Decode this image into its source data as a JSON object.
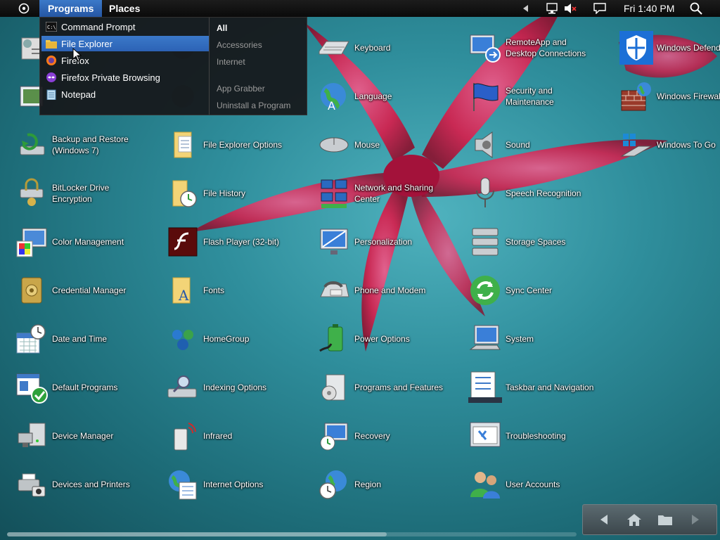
{
  "topbar": {
    "menus": [
      "Programs",
      "Places"
    ],
    "clock": "Fri 1:40 PM"
  },
  "programs_menu": {
    "programs": [
      "Command Prompt",
      "File Explorer",
      "Firefox",
      "Firefox Private Browsing",
      "Notepad"
    ],
    "highlighted": "File Explorer",
    "categories": [
      "All",
      "Accessories",
      "Internet",
      "App Grabber",
      "Uninstall a Program"
    ],
    "selected_category": "All"
  },
  "control_panel": {
    "columns": [
      [
        {
          "label": "",
          "icon": "admin-tools-icon"
        },
        {
          "label": "",
          "icon": "action-center-icon"
        },
        {
          "label": "Backup and Restore\n(Windows 7)",
          "icon": "backup-restore-icon"
        },
        {
          "label": "BitLocker Drive\nEncryption",
          "icon": "bitlocker-icon"
        },
        {
          "label": "Color Management",
          "icon": "color-management-icon"
        },
        {
          "label": "Credential Manager",
          "icon": "credential-manager-icon"
        },
        {
          "label": "Date and Time",
          "icon": "date-time-icon"
        },
        {
          "label": "Default Programs",
          "icon": "default-programs-icon"
        },
        {
          "label": "Device Manager",
          "icon": "device-manager-icon"
        },
        {
          "label": "Devices and Printers",
          "icon": "devices-printers-icon"
        }
      ],
      [
        {
          "label": "",
          "icon": "autoplay-icon"
        },
        {
          "label": "",
          "icon": "backup-icon"
        },
        {
          "label": "File Explorer Options",
          "icon": "folder-options-icon"
        },
        {
          "label": "File History",
          "icon": "file-history-icon"
        },
        {
          "label": "Flash Player (32-bit)",
          "icon": "flash-player-icon"
        },
        {
          "label": "Fonts",
          "icon": "fonts-icon"
        },
        {
          "label": "HomeGroup",
          "icon": "homegroup-icon"
        },
        {
          "label": "Indexing Options",
          "icon": "indexing-options-icon"
        },
        {
          "label": "Infrared",
          "icon": "infrared-icon"
        },
        {
          "label": "Internet Options",
          "icon": "internet-options-icon"
        }
      ],
      [
        {
          "label": "Keyboard",
          "icon": "keyboard-icon"
        },
        {
          "label": "Language",
          "icon": "language-icon"
        },
        {
          "label": "Mouse",
          "icon": "mouse-icon"
        },
        {
          "label": "Network and Sharing\nCenter",
          "icon": "network-sharing-icon"
        },
        {
          "label": "Personalization",
          "icon": "personalization-icon"
        },
        {
          "label": "Phone and Modem",
          "icon": "phone-modem-icon"
        },
        {
          "label": "Power Options",
          "icon": "power-options-icon"
        },
        {
          "label": "Programs and Features",
          "icon": "programs-features-icon"
        },
        {
          "label": "Recovery",
          "icon": "recovery-icon"
        },
        {
          "label": "Region",
          "icon": "region-icon"
        }
      ],
      [
        {
          "label": "RemoteApp and\nDesktop Connections",
          "icon": "remoteapp-icon"
        },
        {
          "label": "Security and\nMaintenance",
          "icon": "security-flag-icon"
        },
        {
          "label": "Sound",
          "icon": "sound-icon"
        },
        {
          "label": "Speech Recognition",
          "icon": "microphone-icon"
        },
        {
          "label": "Storage Spaces",
          "icon": "storage-spaces-icon"
        },
        {
          "label": "Sync Center",
          "icon": "sync-center-icon"
        },
        {
          "label": "System",
          "icon": "system-icon"
        },
        {
          "label": "Taskbar and Navigation",
          "icon": "taskbar-icon"
        },
        {
          "label": "Troubleshooting",
          "icon": "troubleshooting-icon"
        },
        {
          "label": "User Accounts",
          "icon": "user-accounts-icon"
        }
      ],
      [
        {
          "label": "Windows Defend",
          "icon": "windows-defender-icon"
        },
        {
          "label": "Windows Firewall",
          "icon": "windows-firewall-icon"
        },
        {
          "label": "Windows To Go",
          "icon": "windows-to-go-icon"
        }
      ]
    ]
  },
  "colors": {
    "highlight": "#2f66b8",
    "background": "#2f8e9c",
    "flower": "#d81c4a"
  }
}
